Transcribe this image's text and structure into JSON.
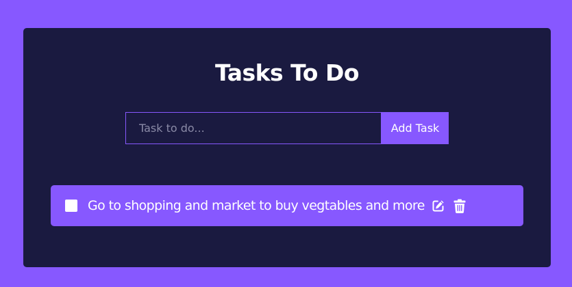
{
  "header": {
    "title": "Tasks To Do"
  },
  "form": {
    "placeholder": "Task to do...",
    "value": "",
    "add_label": "Add Task"
  },
  "tasks": [
    {
      "text": "Go to shopping and market to buy vegtables and more",
      "completed": false
    }
  ],
  "icons": {
    "edit": "edit-icon",
    "delete": "trash-icon"
  },
  "colors": {
    "background": "#8758ff",
    "card": "#1a1a40",
    "accent": "#8758ff",
    "text": "#ffffff"
  }
}
